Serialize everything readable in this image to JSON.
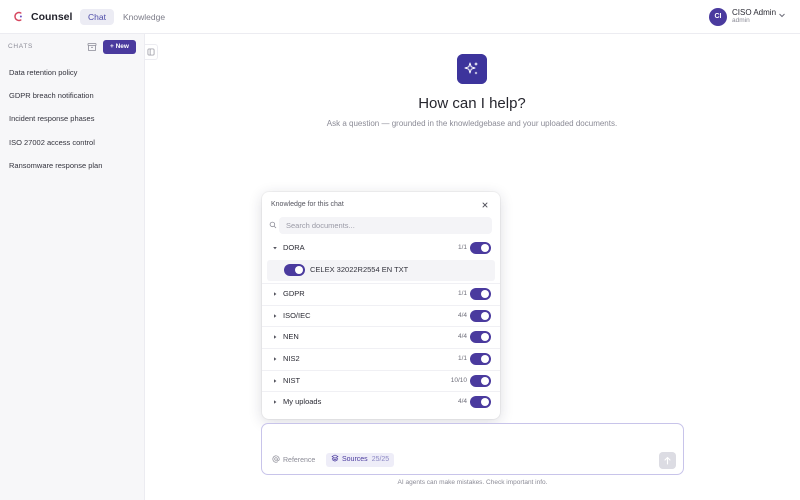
{
  "app": {
    "name": "Counsel"
  },
  "nav": {
    "tabs": [
      {
        "label": "Chat",
        "active": true
      },
      {
        "label": "Knowledge",
        "active": false
      }
    ]
  },
  "user": {
    "initials": "CI",
    "name": "CISO Admin",
    "role": "admin"
  },
  "sidebar": {
    "section_label": "CHATS",
    "new_label": "+ New",
    "items": [
      {
        "label": "Data retention policy"
      },
      {
        "label": "GDPR breach notification"
      },
      {
        "label": "Incident response phases"
      },
      {
        "label": "ISO 27002 access control"
      },
      {
        "label": "Ransomware response plan"
      }
    ]
  },
  "hero": {
    "title": "How can I help?",
    "subtitle": "Ask a question — grounded in the knowledgebase and your uploaded documents."
  },
  "knowledge_popover": {
    "title": "Knowledge for this chat",
    "search_placeholder": "Search documents...",
    "groups": [
      {
        "name": "DORA",
        "count": "1/1",
        "expanded": true,
        "enabled": true,
        "documents": [
          {
            "name": "CELEX 32022R2554 EN TXT",
            "enabled": true
          }
        ]
      },
      {
        "name": "GDPR",
        "count": "1/1",
        "expanded": false,
        "enabled": true
      },
      {
        "name": "ISO/IEC",
        "count": "4/4",
        "expanded": false,
        "enabled": true
      },
      {
        "name": "NEN",
        "count": "4/4",
        "expanded": false,
        "enabled": true
      },
      {
        "name": "NIS2",
        "count": "1/1",
        "expanded": false,
        "enabled": true
      },
      {
        "name": "NIST",
        "count": "10/10",
        "expanded": false,
        "enabled": true
      },
      {
        "name": "My uploads",
        "count": "4/4",
        "expanded": false,
        "enabled": true
      }
    ]
  },
  "composer": {
    "input_value": "",
    "reference_label": "Reference",
    "sources_label": "Sources",
    "sources_count": "25/25"
  },
  "footer": {
    "disclaimer": "AI agents can make mistakes. Check important info."
  },
  "colors": {
    "accent": "#4a3a9e",
    "accent_light": "#eeedf8",
    "sidebar_bg": "#f7f7f9",
    "brand_mark": "#d6455d"
  }
}
